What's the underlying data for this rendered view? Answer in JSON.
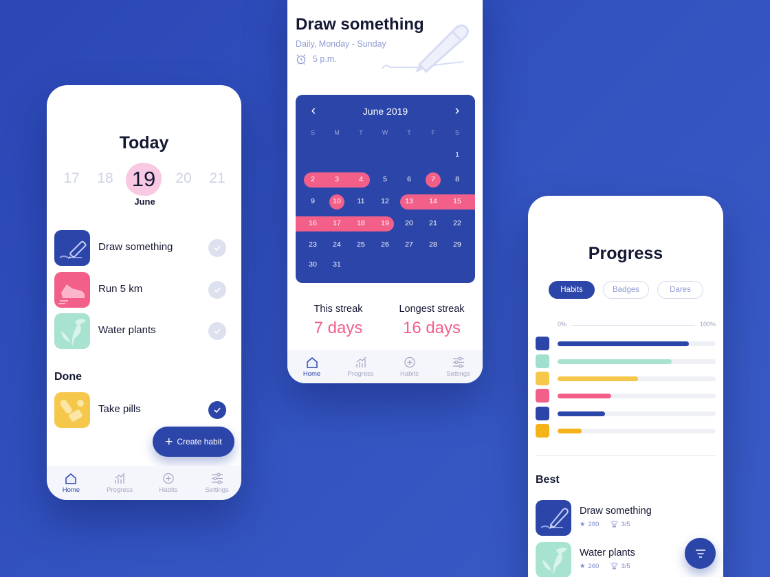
{
  "colors": {
    "background": "#3050bd",
    "primary": "#2c45a8",
    "accent": "#f2608a",
    "muted": "#a3a8c4"
  },
  "today_screen": {
    "title": "Today",
    "dates": [
      "17",
      "18",
      "19",
      "20",
      "21"
    ],
    "current_date": "19",
    "month": "June",
    "habits": [
      {
        "name": "Draw something",
        "icon": "pencil-icon",
        "color": "#2c45a8",
        "done": false
      },
      {
        "name": "Run 5 km",
        "icon": "shoe-icon",
        "color": "#f2608a",
        "done": false
      },
      {
        "name": "Water plants",
        "icon": "leaf-icon",
        "color": "#9fe0cf",
        "done": false
      }
    ],
    "done_label": "Done",
    "done_habits": [
      {
        "name": "Take pills",
        "icon": "pills-icon",
        "color": "#f5c84c",
        "done": true
      }
    ],
    "create_button": "Create habit"
  },
  "tabs": [
    {
      "label": "Home",
      "icon": "home-icon"
    },
    {
      "label": "Progress",
      "icon": "chart-icon"
    },
    {
      "label": "Habits",
      "icon": "plus-circle-icon"
    },
    {
      "label": "Settings",
      "icon": "sliders-icon"
    }
  ],
  "habit_screen": {
    "title": "Draw something",
    "schedule": "Daily, Monday - Sunday",
    "time": "5 p.m.",
    "calendar": {
      "month_label": "June 2019",
      "weekdays": [
        "S",
        "M",
        "T",
        "W",
        "T",
        "F",
        "S"
      ],
      "weeks": [
        [
          "",
          "",
          "",
          "",
          "",
          "",
          "1"
        ],
        [
          "2",
          "3",
          "4",
          "5",
          "6",
          "7",
          "8"
        ],
        [
          "9",
          "10",
          "11",
          "12",
          "13",
          "14",
          "15"
        ],
        [
          "16",
          "17",
          "18",
          "19",
          "20",
          "21",
          "22"
        ],
        [
          "23",
          "24",
          "25",
          "26",
          "27",
          "28",
          "29"
        ],
        [
          "30",
          "31",
          "",
          "",
          "",
          "",
          ""
        ]
      ],
      "completed_days": [
        "2",
        "3",
        "4",
        "7",
        "10",
        "13",
        "14",
        "15",
        "16",
        "17",
        "18",
        "19"
      ]
    },
    "this_streak_label": "This streak",
    "this_streak_value": "7 days",
    "longest_streak_label": "Longest streak",
    "longest_streak_value": "16 days"
  },
  "progress_screen": {
    "title": "Progress",
    "segments": [
      "Habits",
      "Badges",
      "Dares"
    ],
    "scale_min": "0%",
    "scale_max": "100%",
    "bars": [
      {
        "icon": "pencil-icon",
        "color": "#2c45a8",
        "progress": 0.83
      },
      {
        "icon": "leaf-icon",
        "color": "#9fe0cf",
        "progress": 0.72
      },
      {
        "icon": "pills-icon",
        "color": "#f5c84c",
        "progress": 0.51
      },
      {
        "icon": "shoe-icon",
        "color": "#f2608a",
        "progress": 0.34
      },
      {
        "icon": "bike-icon",
        "color": "#2c45a8",
        "progress": 0.3
      },
      {
        "icon": "ticket-icon",
        "color": "#f5b31a",
        "progress": 0.15
      }
    ],
    "best_label": "Best",
    "best": [
      {
        "name": "Draw something",
        "icon": "pencil-icon",
        "stars": "280",
        "trophies": "3/5"
      },
      {
        "name": "Water plants",
        "icon": "leaf-icon",
        "stars": "260",
        "trophies": "3/5"
      }
    ]
  }
}
